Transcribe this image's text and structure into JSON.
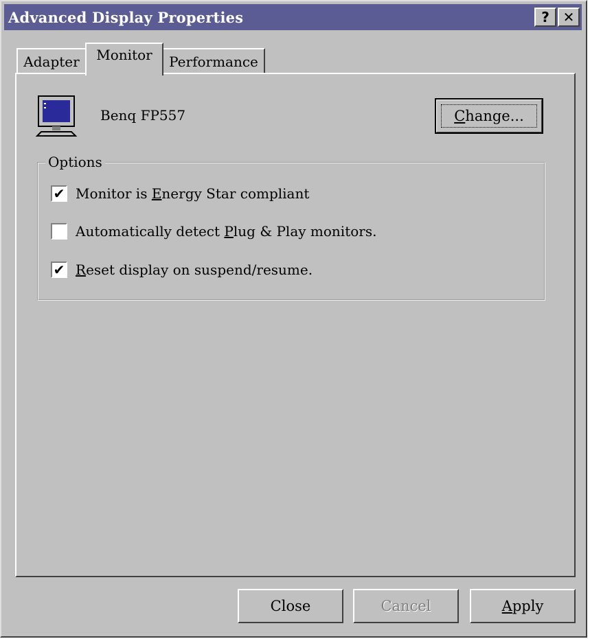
{
  "window": {
    "title": "Advanced Display Properties",
    "help_glyph": "?",
    "close_glyph": "✕"
  },
  "tabs": [
    {
      "label": "Adapter",
      "selected": false
    },
    {
      "label": "Monitor",
      "selected": true
    },
    {
      "label": "Performance",
      "selected": false
    }
  ],
  "monitor": {
    "icon": "monitor-icon",
    "name": "Benq FP557",
    "change_label_pre": "",
    "change_label_accel": "C",
    "change_label_post": "hange..."
  },
  "options": {
    "group_label": "Options",
    "items": [
      {
        "pre": "Monitor is ",
        "accel": "E",
        "post": "nergy Star compliant",
        "checked": true,
        "mark": "✔"
      },
      {
        "pre": "Automatically detect ",
        "accel": "P",
        "post": "lug & Play monitors.",
        "checked": false,
        "mark": ""
      },
      {
        "pre": "",
        "accel": "R",
        "post": "eset display on suspend/resume.",
        "checked": true,
        "mark": "✔"
      }
    ]
  },
  "buttons": {
    "close": "Close",
    "cancel": "Cancel",
    "apply_accel": "A",
    "apply_post": "pply"
  },
  "colors": {
    "titlebar": "#5c5c94",
    "face": "#c0c0c0"
  }
}
